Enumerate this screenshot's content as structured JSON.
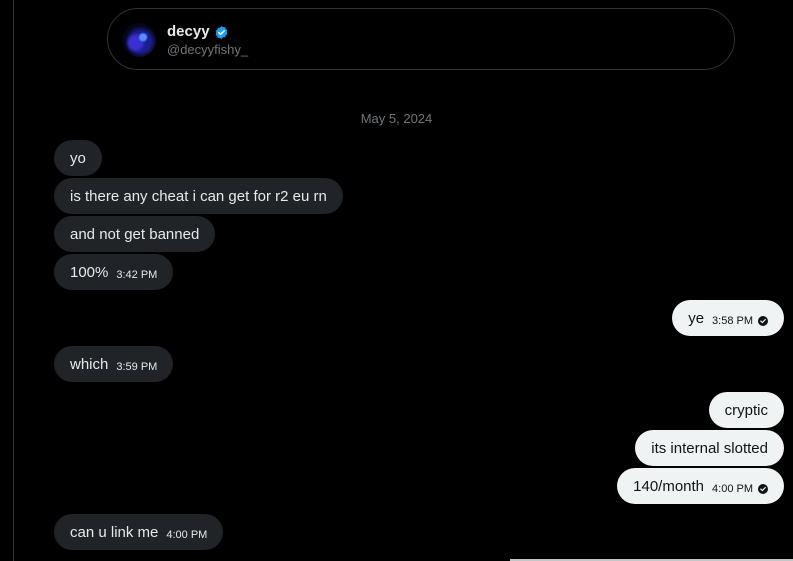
{
  "profile": {
    "display_name": "decyy",
    "handle": "@decyyfishy_",
    "verified_icon": "verified-badge-icon",
    "verified_color": "#1d9bf0"
  },
  "conversation": {
    "date_separator": "May 5, 2024",
    "messages": [
      {
        "direction": "in",
        "text": "yo",
        "time": ""
      },
      {
        "direction": "in",
        "text": "is there any cheat i can get for r2 eu rn",
        "time": ""
      },
      {
        "direction": "in",
        "text": "and not get banned",
        "time": ""
      },
      {
        "direction": "in",
        "text": "100%",
        "time": "3:42 PM"
      },
      {
        "direction": "out",
        "text": "ye",
        "time": "3:58 PM",
        "seen": true
      },
      {
        "direction": "in",
        "text": "which",
        "time": "3:59 PM"
      },
      {
        "direction": "out",
        "text": "cryptic",
        "time": ""
      },
      {
        "direction": "out",
        "text": "its internal slotted",
        "time": ""
      },
      {
        "direction": "out",
        "text": "140/month",
        "time": "4:00 PM",
        "seen": true
      },
      {
        "direction": "in",
        "text": "can u link me",
        "time": "4:00 PM"
      }
    ]
  },
  "colors": {
    "background": "#000000",
    "incoming_bubble": "#202327",
    "outgoing_bubble": "#eff3f4",
    "secondary_text": "#71767b"
  }
}
